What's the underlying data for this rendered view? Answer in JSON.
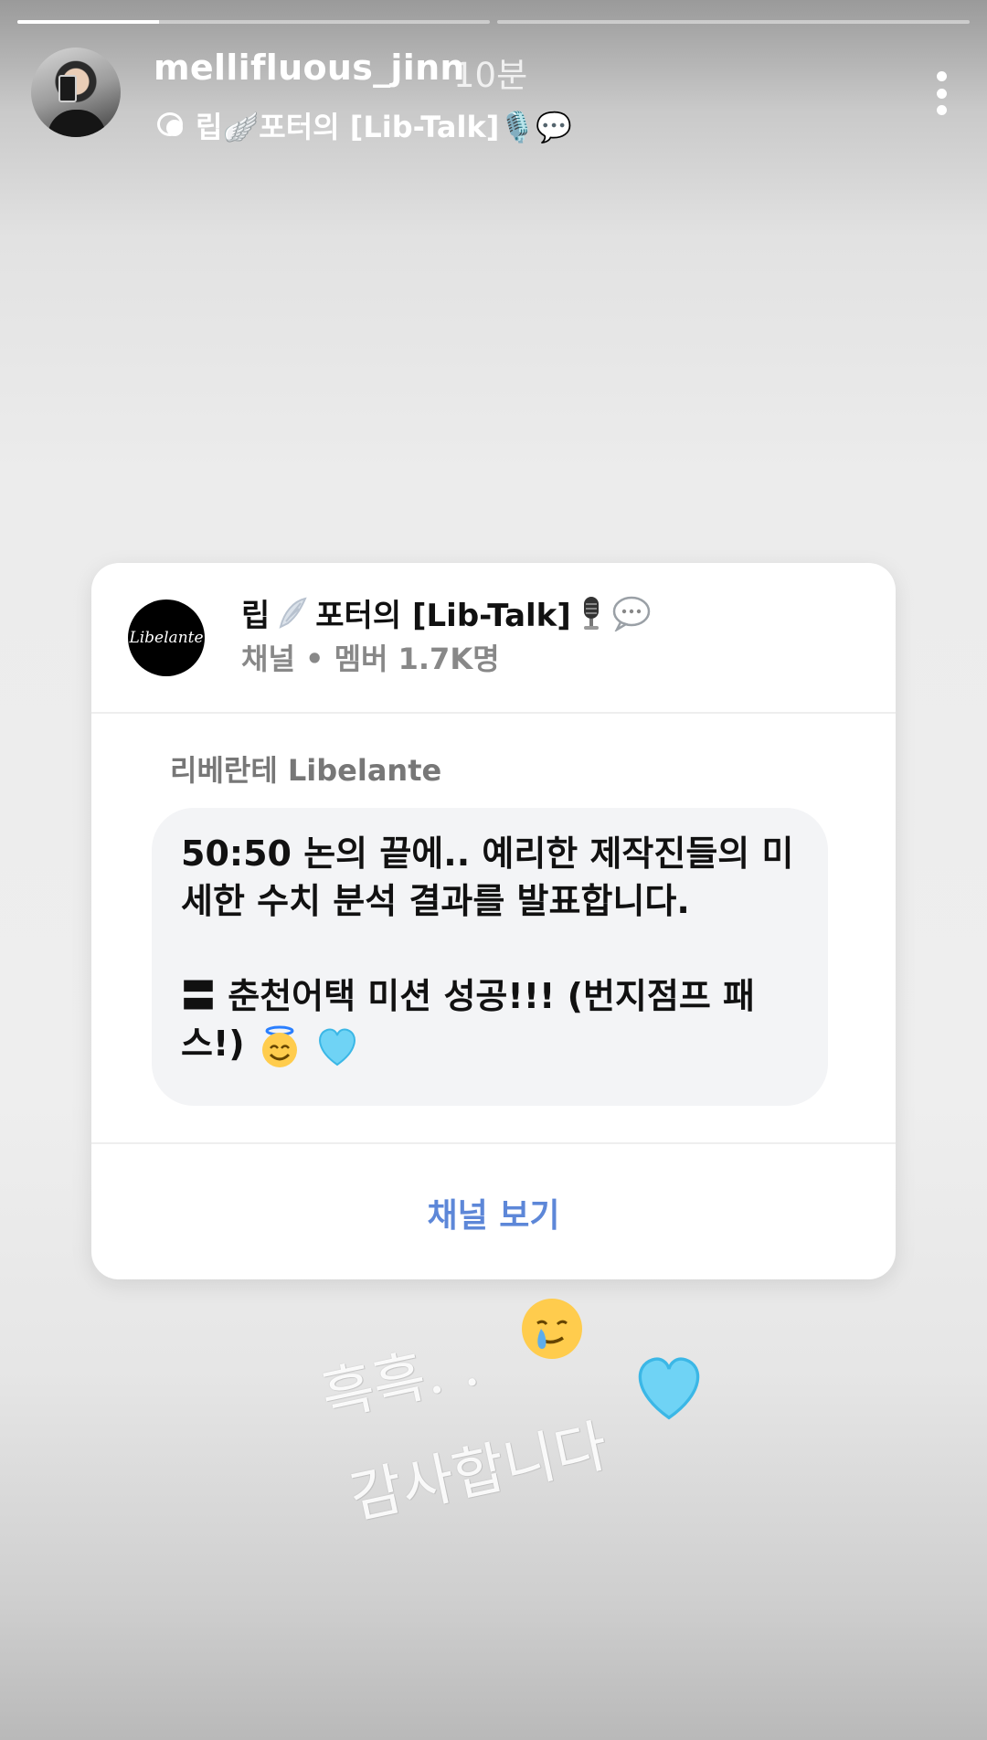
{
  "story": {
    "progress": [
      0.3,
      0.0
    ],
    "username": "mellifluous_jinn",
    "time": "10분",
    "subtitle": "립🪽포터의 [Lib-Talk]🎙️💬"
  },
  "card": {
    "logo_text": "Libelante",
    "title_prefix": "립",
    "title_suffix": "포터의 [Lib-Talk]",
    "meta": "채널 • 멤버 1.7K명",
    "author": "리베란테 Libelante",
    "message_line1": "50:50 논의 끝에.. 예리한 제작진들의 미세한 수치 분석 결과를 발표합니다.",
    "message_line2_prefix": "〓 춘천어택 미션 성공!!! (번지점프 패스!)",
    "view_button": "채널 보기"
  },
  "overlay": {
    "line1": "흑흑. .",
    "line2": "감사합니다"
  },
  "icons": {
    "subtitle_icon": "chat-bubbles-icon",
    "more": "more-vertical-icon"
  },
  "colors": {
    "accent": "#5d87d8",
    "bubble_bg": "#f3f4f6"
  }
}
